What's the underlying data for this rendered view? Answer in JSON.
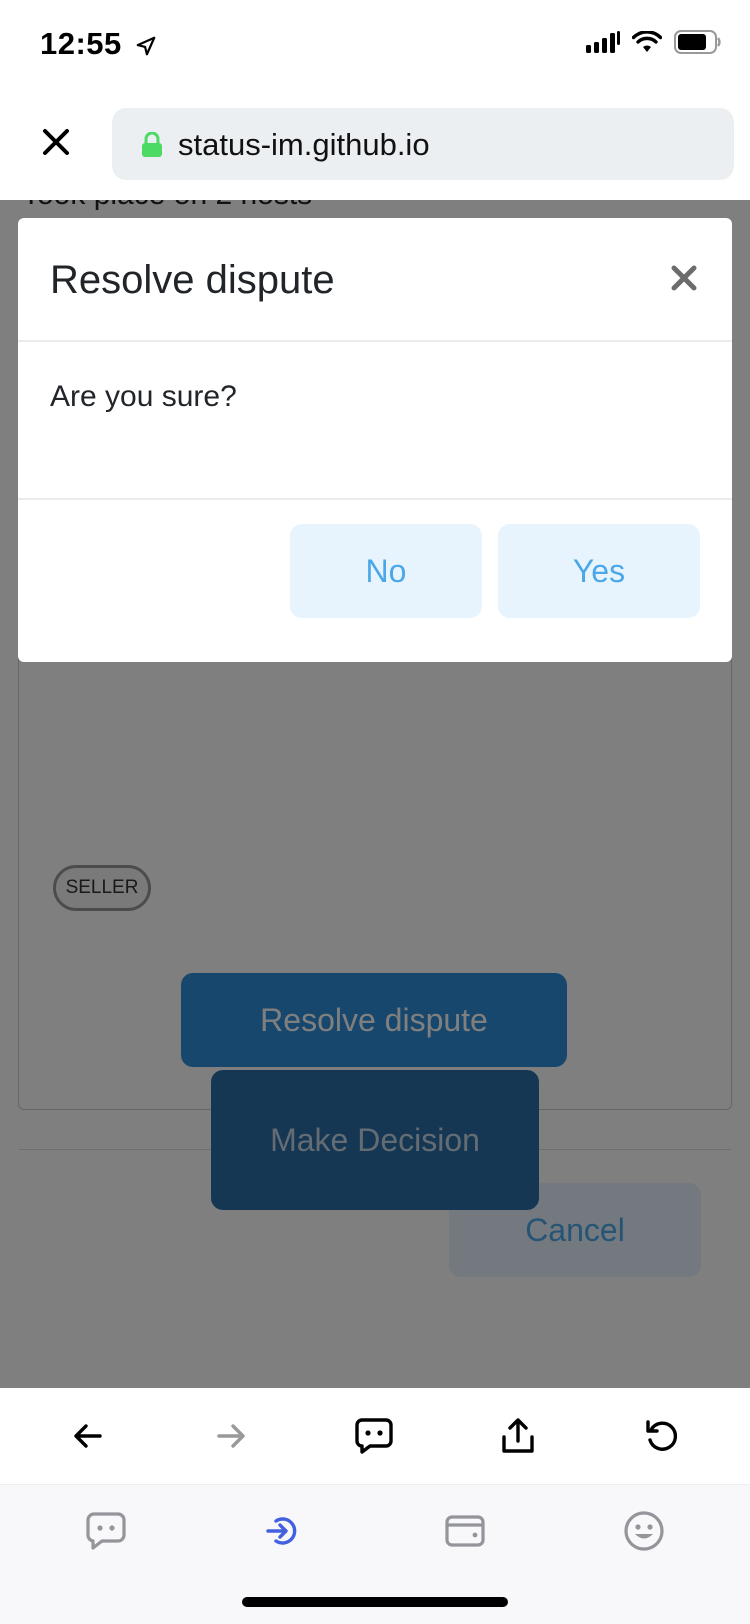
{
  "status_bar": {
    "time": "12:55"
  },
  "browser": {
    "url": "status-im.github.io"
  },
  "background_page": {
    "partial_text": "Took place on 2 hosts",
    "seller_badge": "SELLER",
    "resolve_button": "Resolve dispute",
    "cancel_button": "Cancel",
    "make_decision_button": "Make Decision"
  },
  "dialog": {
    "title": "Resolve dispute",
    "message": "Are you sure?",
    "no_label": "No",
    "yes_label": "Yes"
  },
  "icons": {
    "status": [
      "location-arrow-icon",
      "cellular-signal-icon",
      "wifi-icon",
      "battery-icon"
    ],
    "toolbar": [
      "back-arrow-icon",
      "forward-arrow-icon",
      "chat-icon",
      "share-icon",
      "reload-icon"
    ],
    "tabs": [
      "chat-tab-icon",
      "browser-tab-icon",
      "wallet-tab-icon",
      "profile-tab-icon"
    ]
  },
  "colors": {
    "accent": "#4ba8e8",
    "primary_button": "#2f8fd8",
    "active_tab": "#4360df",
    "inactive_tab": "#93959b"
  }
}
